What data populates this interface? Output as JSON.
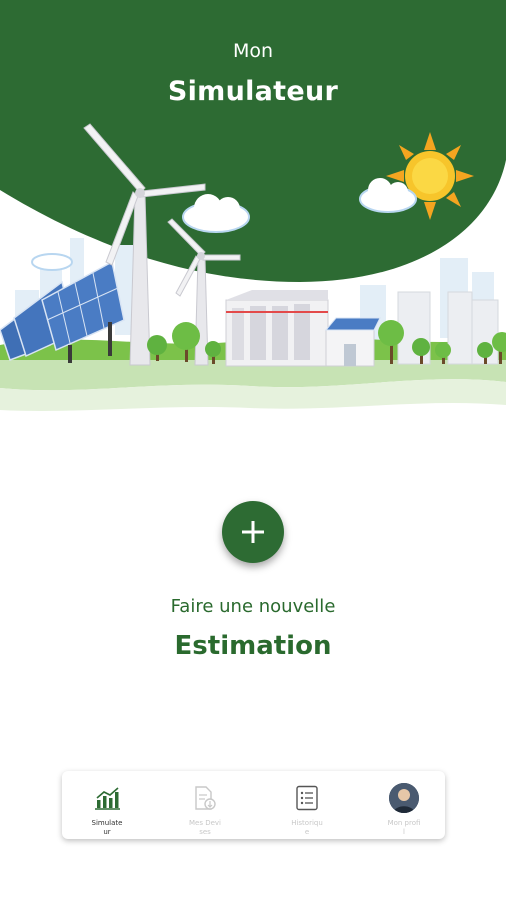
{
  "header": {
    "title_small": "Mon",
    "title_big": "Simulateur"
  },
  "main": {
    "add_icon": "plus-icon",
    "cta_line1": "Faire une nouvelle",
    "cta_line2": "Estimation"
  },
  "colors": {
    "brand_green": "#2d6b33",
    "text_green": "#2a6a2e"
  },
  "navbar": {
    "items": [
      {
        "label": "Simulateur",
        "icon": "chart-bar-icon",
        "active": true
      },
      {
        "label": "Mes Devises",
        "icon": "document-download-icon",
        "active": false
      },
      {
        "label": "Historique",
        "icon": "list-icon",
        "active": false
      },
      {
        "label": "Mon profil",
        "icon": "avatar",
        "active": false
      }
    ]
  }
}
